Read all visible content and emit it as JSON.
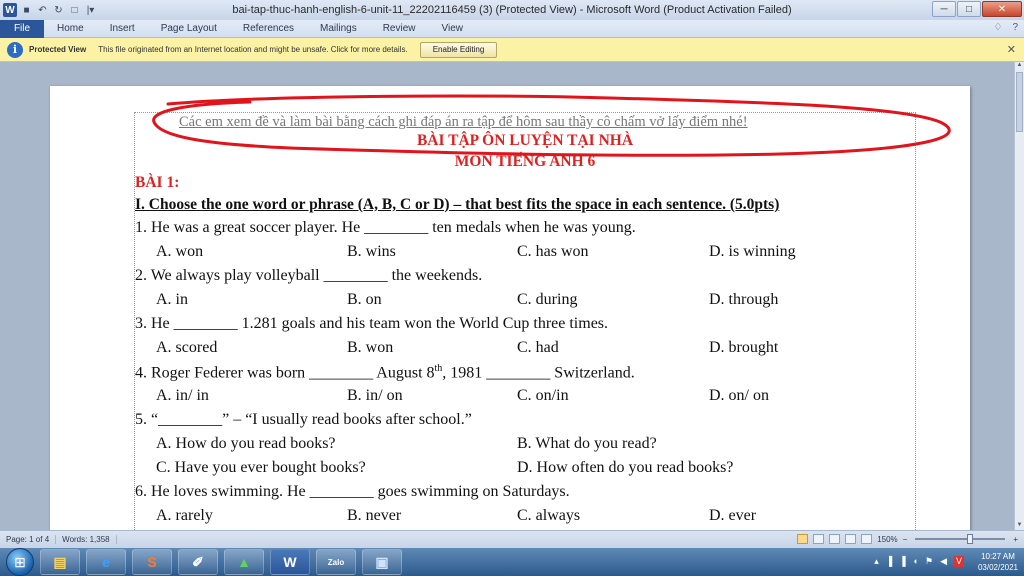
{
  "window": {
    "title": "bai-tap-thuc-hanh-english-6-unit-11_22202116459 (3) (Protected View)  -  Microsoft Word (Product Activation Failed)",
    "qat": {
      "word_logo": "W",
      "save": "■",
      "undo": "↶",
      "redo": "↻",
      "new": "□",
      "customize": "|▾"
    },
    "controls": {
      "minimize": "─",
      "maximize": "□",
      "close": "✕"
    }
  },
  "ribbon": {
    "file_tab": "File",
    "tabs": [
      "Home",
      "Insert",
      "Page Layout",
      "References",
      "Mailings",
      "Review",
      "View"
    ],
    "right_icons": [
      "♢",
      "?"
    ]
  },
  "protected_view": {
    "title": "Protected View",
    "message": "This file originated from an Internet location and might be unsafe. Click for more details.",
    "button": "Enable Editing",
    "close": "✕"
  },
  "document": {
    "note": "Các em xem đề và làm bài bằng cách ghi đáp án ra tập để hôm sau thầy cô chấm vở lấy điểm nhé!",
    "heading1": "BÀI TẬP ÔN LUYỆN TẠI NHÀ",
    "heading2": "MÔN TIẾNG ANH 6",
    "exercise": "BÀI 1:",
    "section": "I. Choose the one word or phrase (A, B, C or D) – that best fits the space in each sentence. (5.0pts)",
    "q1": "1. He was a great soccer player. He ________ ten medals when he was young.",
    "q1_opts": [
      "A. won",
      "B. wins",
      "C. has won",
      "D. is winning"
    ],
    "q2": "2. We always play volleyball ________ the weekends.",
    "q2_opts": [
      "A. in",
      "B. on",
      "C. during",
      "D. through"
    ],
    "q3": "3. He ________ 1.281 goals and his team won the World Cup three times.",
    "q3_opts": [
      "A. scored",
      "B. won",
      "C. had",
      "D. brought"
    ],
    "q4_a": "4. Roger Federer was born ________ August 8",
    "q4_sup": "th",
    "q4_b": ", 1981 ________ Switzerland.",
    "q4_opts": [
      "A. in/ in",
      "B. in/ on",
      "C. on/in",
      "D. on/ on"
    ],
    "q5": "5. “________” – “I usually read books after school.”",
    "q5_opts": [
      "A. How do you read books?",
      "B. What do you read?",
      "C. Have you ever bought books?",
      "D. How often do you read books?"
    ],
    "q6": "6. He loves swimming. He ________ goes swimming on Saturdays.",
    "q6_opts": [
      "A. rarely",
      "B. never",
      "C. always",
      "D. ever"
    ]
  },
  "status": {
    "page": "Page: 1 of 4",
    "words": "Words: 1,358",
    "zoom": "150%",
    "zoom_minus": "−",
    "zoom_plus": "+"
  },
  "taskbar": {
    "apps": [
      "▤",
      "e",
      "S",
      "✐",
      "▲",
      "W",
      "Zalo",
      "▣"
    ],
    "tray": [
      "▴",
      "▐",
      "▐",
      "◖",
      "⚑",
      "◀",
      "V"
    ],
    "time": "10:27 AM",
    "date": "03/02/2021"
  }
}
